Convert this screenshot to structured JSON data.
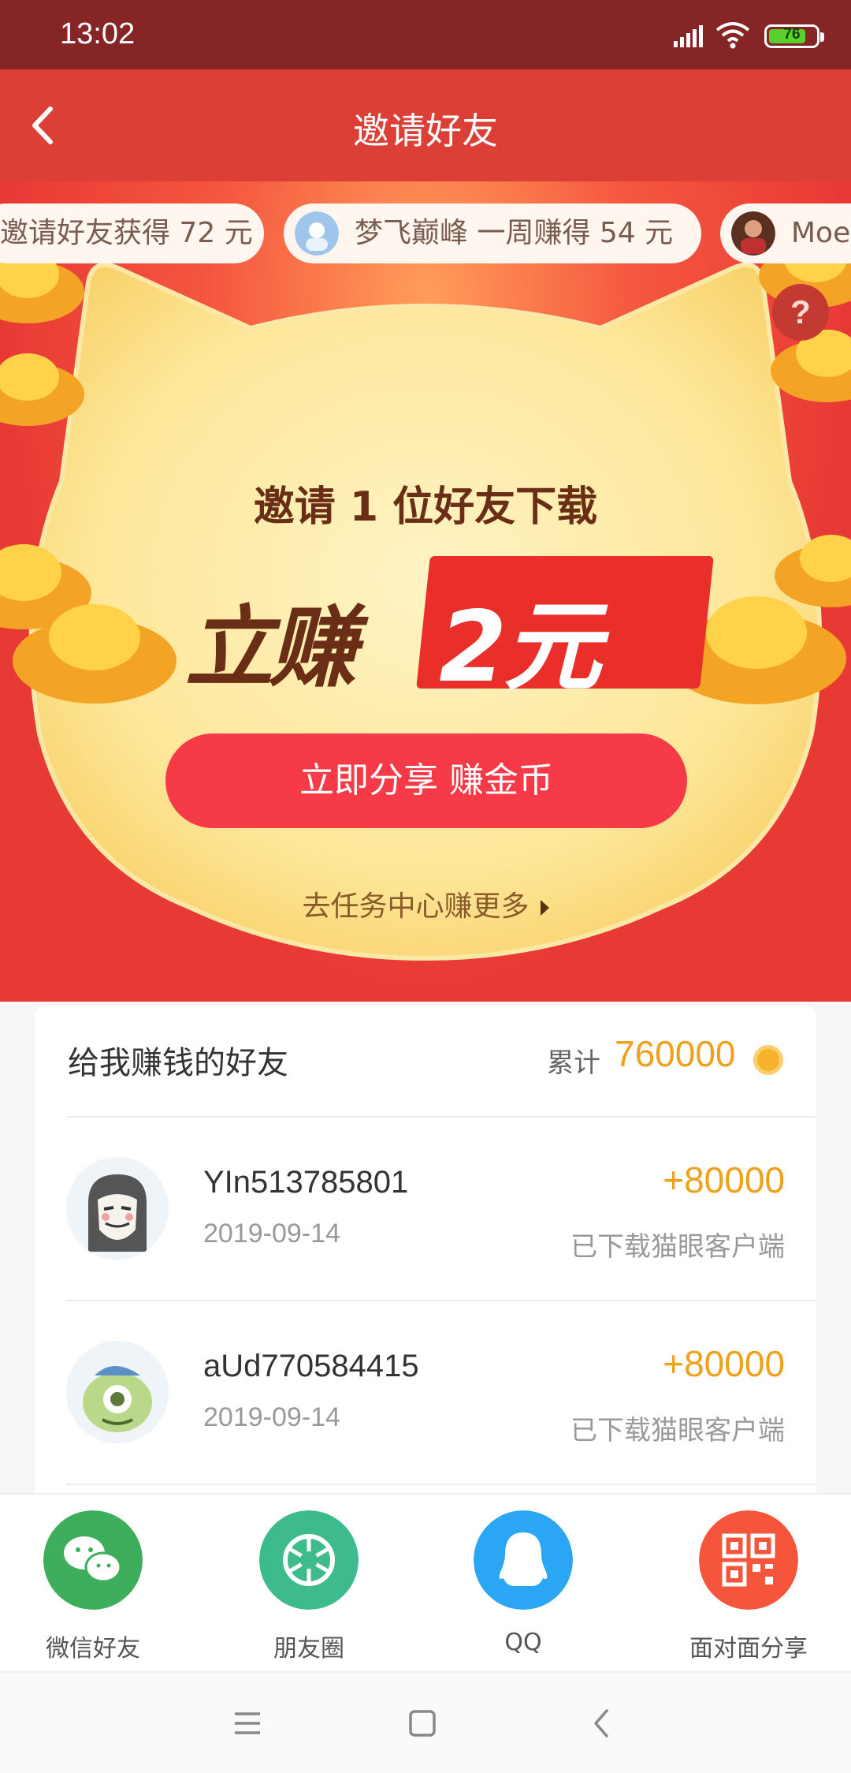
{
  "status_bar": {
    "time": "13:02",
    "battery": "76"
  },
  "header": {
    "title": "邀请好友"
  },
  "ticker": [
    {
      "text": "邀请好友获得 72 元"
    },
    {
      "text": "梦飞巅峰 一周赚得 54 元"
    },
    {
      "text": "Moe"
    }
  ],
  "hero": {
    "help": "?",
    "invite_line": "邀请 1 位好友下载",
    "earn_prefix": "立赚",
    "earn_amount": "2元",
    "share_button": "立即分享 赚金币",
    "task_link": "去任务中心赚更多"
  },
  "friends": {
    "title": "给我赚钱的好友",
    "total_label": "累计",
    "total_value": "760000",
    "rows": [
      {
        "name": "YIn513785801",
        "date": "2019-09-14",
        "points": "+80000",
        "status": "已下载猫眼客户端"
      },
      {
        "name": "aUd770584415",
        "date": "2019-09-14",
        "points": "+80000",
        "status": "已下载猫眼客户端"
      }
    ]
  },
  "share_options": [
    {
      "label": "微信好友",
      "color": "#3fae5c",
      "icon": "wechat-icon"
    },
    {
      "label": "朋友圈",
      "color": "#3dbb8c",
      "icon": "moments-icon"
    },
    {
      "label": "QQ",
      "color": "#2aa6f4",
      "icon": "qq-icon"
    },
    {
      "label": "面对面分享",
      "color": "#f5553a",
      "icon": "qr-code-icon"
    }
  ]
}
